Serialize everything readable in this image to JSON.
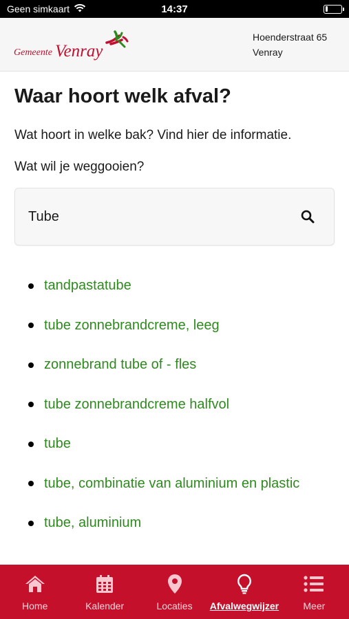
{
  "status_bar": {
    "carrier": "Geen simkaart",
    "time": "14:37",
    "battery_level": 0.18
  },
  "header": {
    "logo_small": "Gemeente",
    "logo_big": "Venray",
    "address_line1": "Hoenderstraat 65",
    "address_line2": "Venray"
  },
  "main": {
    "title": "Waar hoort welk afval?",
    "intro": "Wat hoort in welke bak? Vind hier de informatie.",
    "question": "Wat wil je weggooien?",
    "search_value": "Tube",
    "search_icon": "search-icon",
    "results": [
      "tandpastatube",
      "tube zonnebrandcreme, leeg",
      "zonnebrand tube of - fles",
      "tube zonnebrandcreme halfvol",
      "tube",
      "tube, combinatie van aluminium en plastic",
      "tube, aluminium"
    ]
  },
  "tabbar": {
    "tabs": [
      {
        "label": "Home",
        "icon": "home-icon",
        "active": false
      },
      {
        "label": "Kalender",
        "icon": "calendar-icon",
        "active": false
      },
      {
        "label": "Locaties",
        "icon": "location-pin-icon",
        "active": false
      },
      {
        "label": "Afvalwegwijzer",
        "icon": "lightbulb-icon",
        "active": true
      },
      {
        "label": "Meer",
        "icon": "list-icon",
        "active": false
      }
    ]
  },
  "colors": {
    "brand_red": "#c5102c",
    "link_green": "#2e8a1e",
    "header_bg": "#f6f6f6"
  }
}
